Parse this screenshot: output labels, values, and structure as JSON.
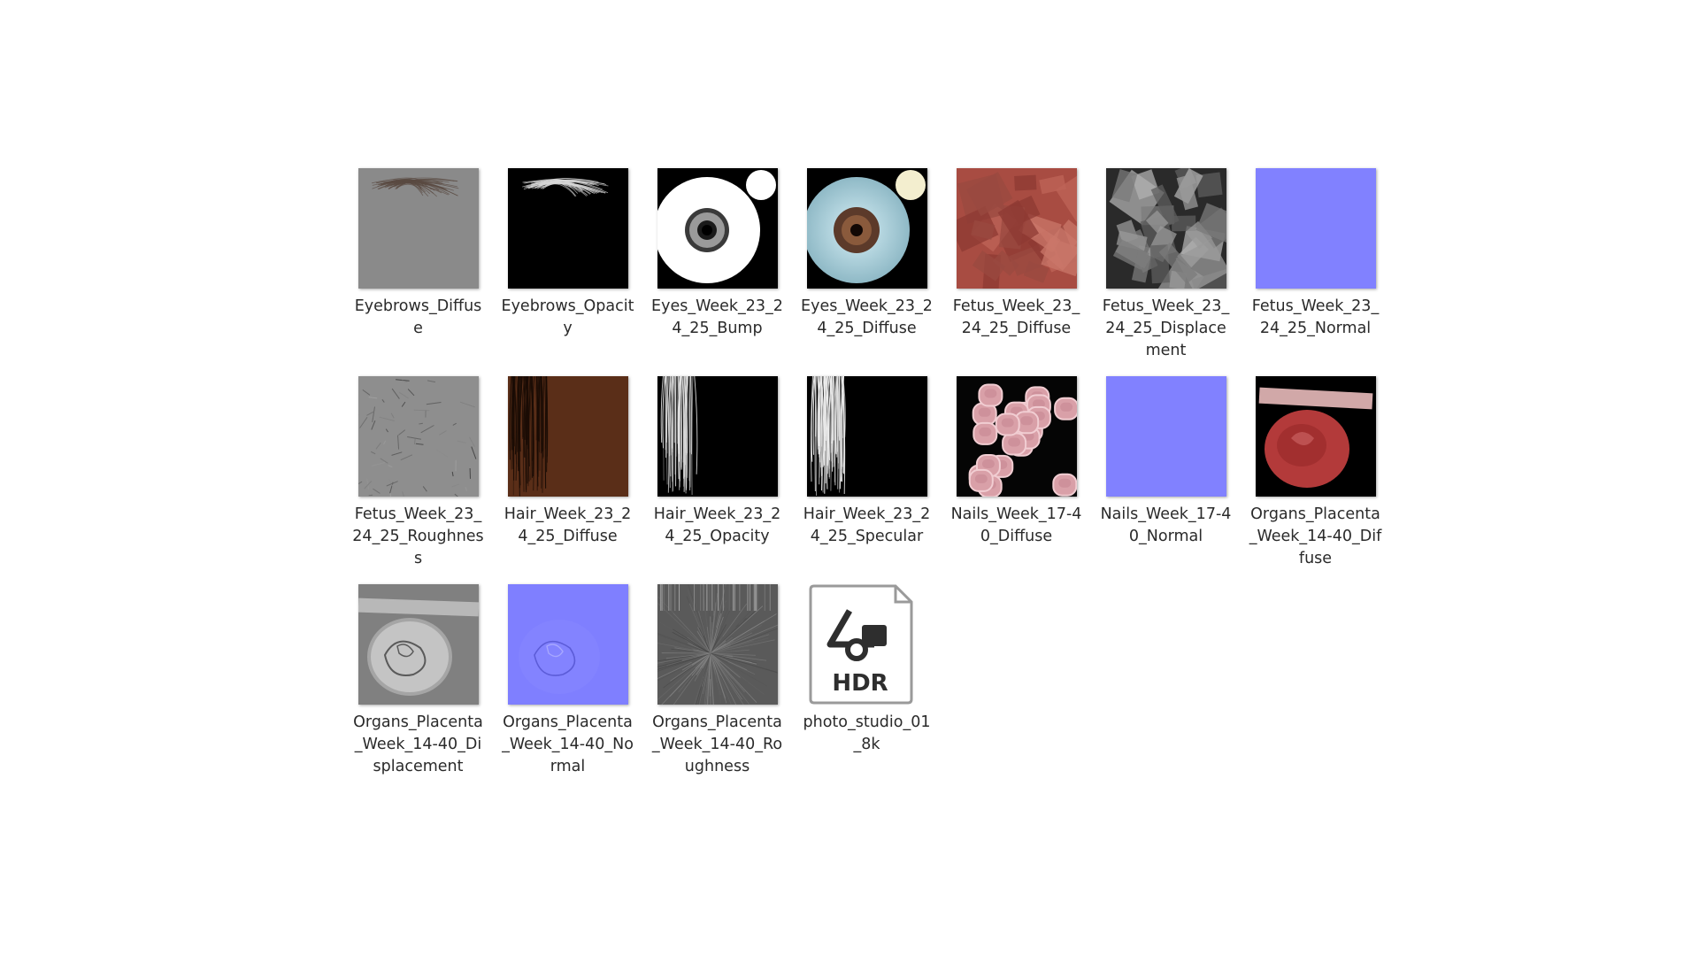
{
  "files": [
    {
      "name": "Eyebrows_Diffuse",
      "thumb": "eyebrows-diffuse"
    },
    {
      "name": "Eyebrows_Opacity",
      "thumb": "eyebrows-opacity"
    },
    {
      "name": "Eyes_Week_23_24_25_Bump",
      "thumb": "eyes-bump"
    },
    {
      "name": "Eyes_Week_23_24_25_Diffuse",
      "thumb": "eyes-diffuse"
    },
    {
      "name": "Fetus_Week_23_24_25_Diffuse",
      "thumb": "fetus-diffuse"
    },
    {
      "name": "Fetus_Week_23_24_25_Displacement",
      "thumb": "fetus-displacement"
    },
    {
      "name": "Fetus_Week_23_24_25_Normal",
      "thumb": "normal-map"
    },
    {
      "name": "Fetus_Week_23_24_25_Roughness",
      "thumb": "fetus-roughness"
    },
    {
      "name": "Hair_Week_23_24_25_Diffuse",
      "thumb": "hair-diffuse"
    },
    {
      "name": "Hair_Week_23_24_25_Opacity",
      "thumb": "hair-opacity"
    },
    {
      "name": "Hair_Week_23_24_25_Specular",
      "thumb": "hair-specular"
    },
    {
      "name": "Nails_Week_17-40_Diffuse",
      "thumb": "nails-diffuse"
    },
    {
      "name": "Nails_Week_17-40_Normal",
      "thumb": "normal-map"
    },
    {
      "name": "Organs_Placenta_Week_14-40_Diffuse",
      "thumb": "placenta-diffuse"
    },
    {
      "name": "Organs_Placenta_Week_14-40_Displacement",
      "thumb": "placenta-displacement"
    },
    {
      "name": "Organs_Placenta_Week_14-40_Normal",
      "thumb": "placenta-normal"
    },
    {
      "name": "Organs_Placenta_Week_14-40_Roughness",
      "thumb": "placenta-roughness"
    },
    {
      "name": "photo_studio_01_8k",
      "thumb": "hdr-file-icon",
      "badge": "HDR"
    }
  ],
  "colors": {
    "normal_blue": "#7f7fff",
    "label_text": "#2a2a2a",
    "hair_brown": "#5a2e18",
    "placenta_red": "#b33a3a"
  }
}
